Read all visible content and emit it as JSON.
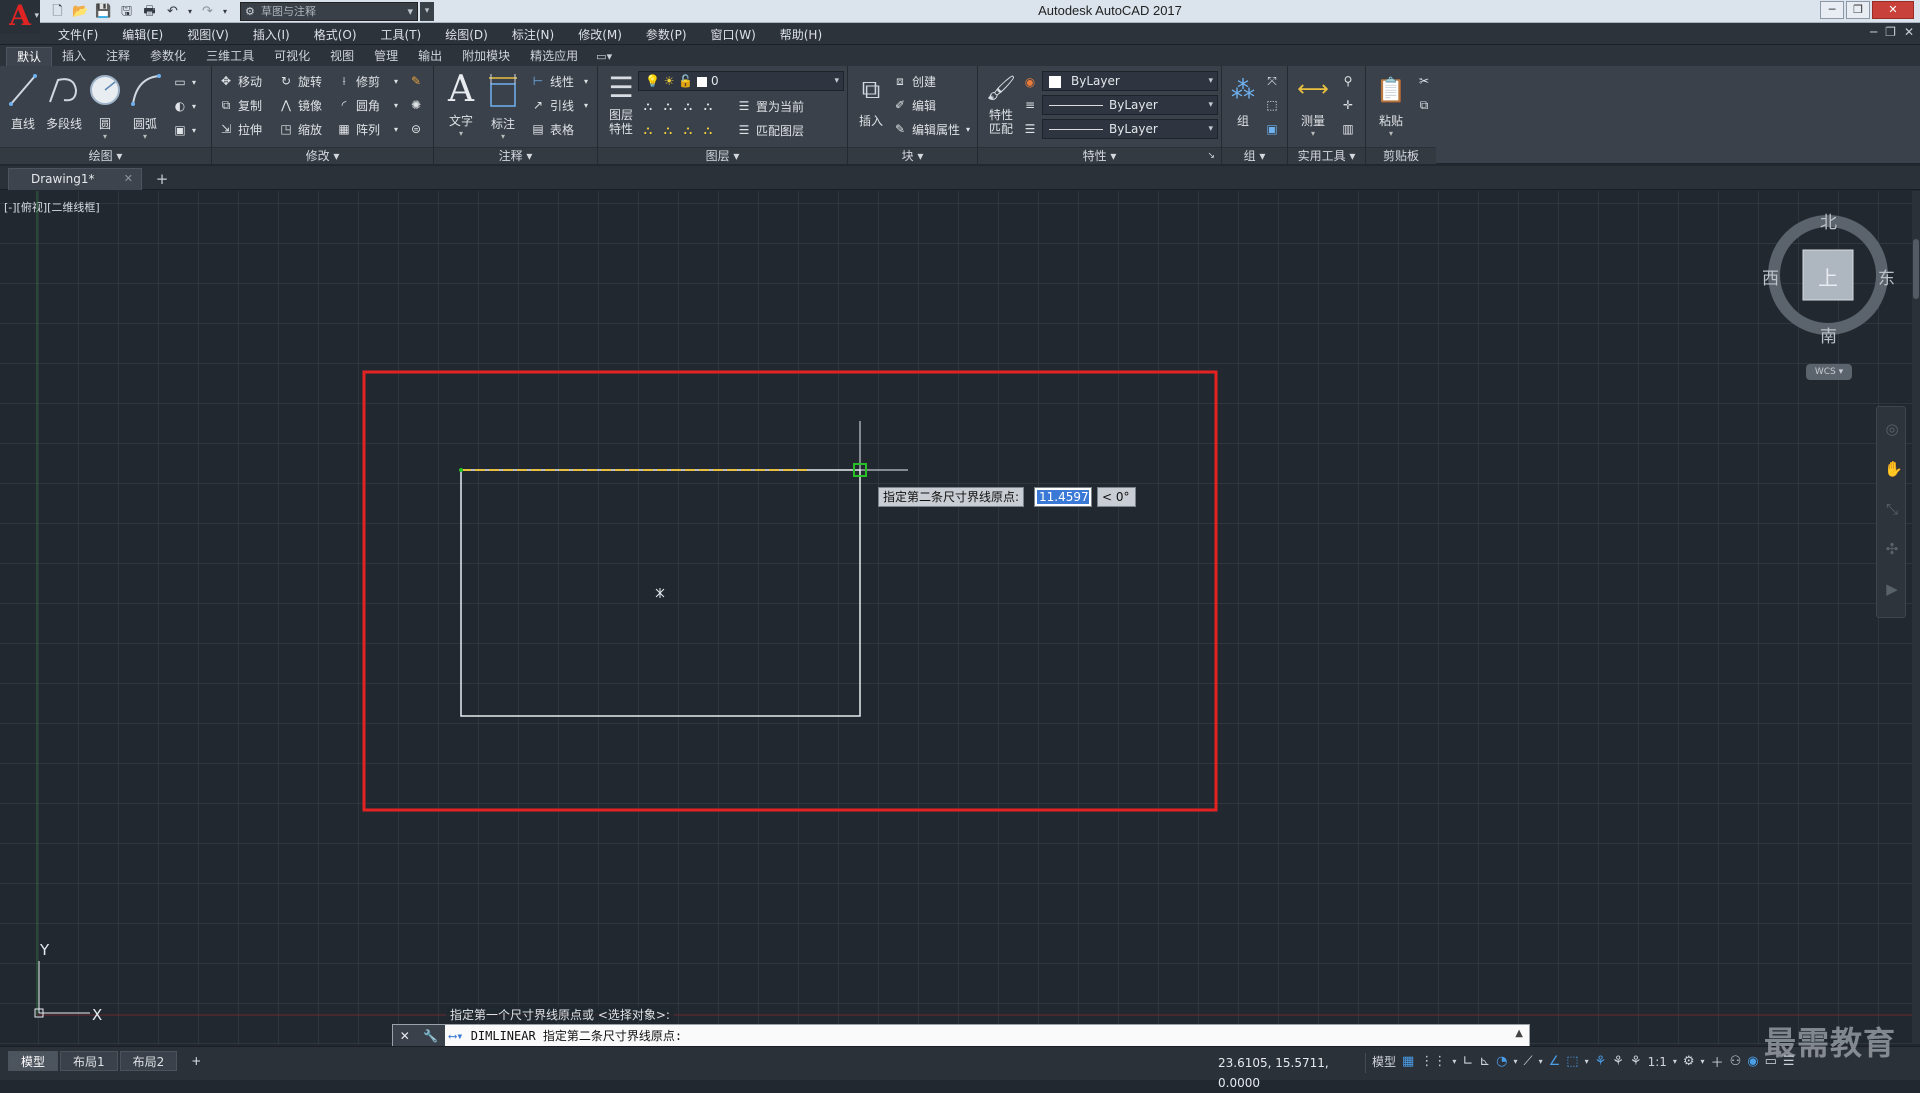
{
  "app": {
    "title": "Autodesk AutoCAD 2017",
    "logo_letter": "A",
    "workspace": "草图与注释"
  },
  "menus": [
    "文件(F)",
    "编辑(E)",
    "视图(V)",
    "插入(I)",
    "格式(O)",
    "工具(T)",
    "绘图(D)",
    "标注(N)",
    "修改(M)",
    "参数(P)",
    "窗口(W)",
    "帮助(H)"
  ],
  "ribbon_tabs": [
    "默认",
    "插入",
    "注释",
    "参数化",
    "三维工具",
    "可视化",
    "视图",
    "管理",
    "输出",
    "附加模块",
    "精选应用"
  ],
  "ribbon_tab_extra": "▭▾",
  "panels": {
    "draw": {
      "title": "绘图",
      "line": "直线",
      "polyline": "多段线",
      "circle": "圆",
      "arc": "圆弧"
    },
    "modify": {
      "title": "修改",
      "move": "移动",
      "rotate": "旋转",
      "trim": "修剪",
      "copy": "复制",
      "mirror": "镜像",
      "fillet": "圆角",
      "stretch": "拉伸",
      "scale": "缩放",
      "array": "阵列"
    },
    "annotation": {
      "title": "注释",
      "text": "文字",
      "dimension": "标注",
      "linear": "线性",
      "leader": "引线",
      "table": "表格"
    },
    "layers": {
      "title": "图层",
      "layer_props": "图层\n特性",
      "current_layer": "0",
      "set_current": "置为当前",
      "match_layer": "匹配图层"
    },
    "block": {
      "title": "块",
      "insert": "插入",
      "create": "创建",
      "edit": "编辑",
      "edit_attr": "编辑属性"
    },
    "properties": {
      "title": "特性",
      "match": "特性\n匹配",
      "color": "ByLayer",
      "linetype": "ByLayer",
      "lineweight": "ByLayer"
    },
    "groups": {
      "title": "组",
      "group": "组"
    },
    "utilities": {
      "title": "实用工具",
      "measure": "测量"
    },
    "clipboard": {
      "title": "剪贴板",
      "paste": "粘贴"
    }
  },
  "file_tab": "Drawing1*",
  "viewport_label": "[-][俯视][二维线框]",
  "viewcube": {
    "north": "北",
    "south": "南",
    "east": "东",
    "west": "西",
    "face": "上",
    "wcs": "WCS"
  },
  "dynamic_input": {
    "prompt": "指定第二条尺寸界线原点:",
    "value": "11.4597",
    "angle": "< 0°"
  },
  "ucs": {
    "x": "X",
    "y": "Y"
  },
  "command": {
    "history": "指定第一个尺寸界线原点或 <选择对象>:",
    "current": "DIMLINEAR 指定第二条尺寸界线原点:"
  },
  "layout_tabs": [
    "模型",
    "布局1",
    "布局2"
  ],
  "status": {
    "coords": "23.6105, 15.5711, 0.0000",
    "model": "模型",
    "scale": "1:1"
  },
  "watermark": "最需教育",
  "colors": {
    "highlight_rect": "#e52222",
    "accent": "#4a9ee8",
    "dim_dash": "#e8c040",
    "snap_marker": "#27c027"
  }
}
